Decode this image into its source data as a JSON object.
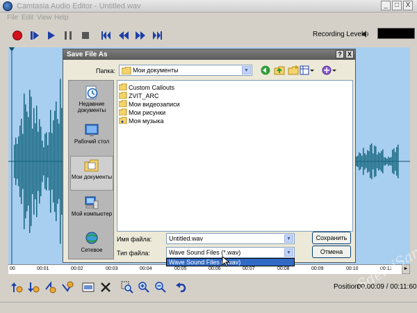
{
  "window": {
    "title": "Camtasia Audio Editor - Untitled.wav",
    "controls": [
      "_",
      "□",
      "X"
    ]
  },
  "menu": [
    "File",
    "Edit",
    "View",
    "Help"
  ],
  "toolbar": {
    "buttons": [
      "record-icon",
      "play-selection-icon",
      "play-icon",
      "pause-icon",
      "stop-icon",
      "skip-start-icon",
      "rewind-icon",
      "fast-forward-icon",
      "skip-end-icon"
    ],
    "recording_level_label": "Recording Level:",
    "accent_color": "#1c3fa8",
    "record_color": "#d4101c"
  },
  "timeline": {
    "ticks": [
      "00",
      "00:01",
      "00:02",
      "00:03",
      "00:04",
      "00:05",
      "00:06",
      "00:07",
      "00:08",
      "00:09",
      "00:10",
      "00:11"
    ]
  },
  "status": {
    "position_label": "Position:",
    "position_value": "00:00:09 / 00:11:60"
  },
  "dialog": {
    "title": "Save File As",
    "lookin_label": "Папка:",
    "lookin_value": "Мои документы",
    "places": [
      {
        "label": "Недавние документы",
        "icon": "recent-docs-icon"
      },
      {
        "label": "Рабочий стол",
        "icon": "desktop-icon"
      },
      {
        "label": "Мои документы",
        "icon": "my-documents-icon",
        "selected": true
      },
      {
        "label": "Мой компьютер",
        "icon": "my-computer-icon"
      },
      {
        "label": "Сетевое",
        "icon": "network-icon"
      }
    ],
    "files": [
      "Custom Callouts",
      "ZVIT_ARC",
      "Мои видеозаписи",
      "Мои рисунки",
      "Моя музыка"
    ],
    "filename_label": "Имя файла:",
    "filename_value": "Untitled.wav",
    "filetype_label": "Тип файла:",
    "filetype_value": "Wave Sound Files (*.wav)",
    "filetype_dropdown_option": "Wave Sound Files (*.wav)",
    "save_button": "Сохранить",
    "cancel_button": "Отмена"
  },
  "watermark": "SdelaiSam"
}
